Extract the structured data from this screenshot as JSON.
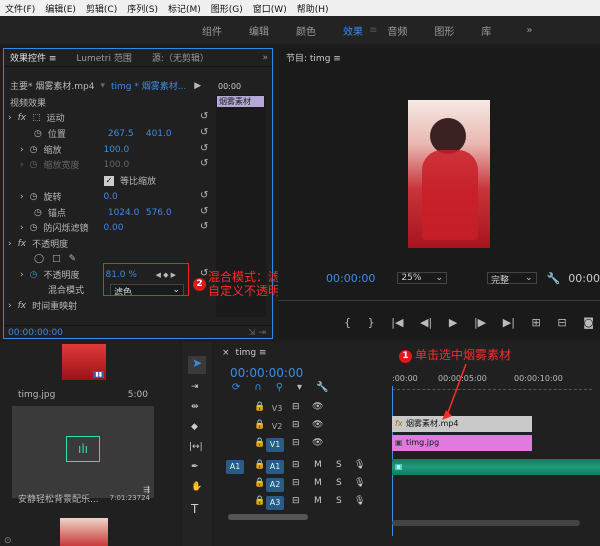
{
  "menu": [
    "文件(F)",
    "编辑(E)",
    "剪辑(C)",
    "序列(S)",
    "标记(M)",
    "图形(G)",
    "窗口(W)",
    "帮助(H)"
  ],
  "workspaces": [
    "组件",
    "编辑",
    "颜色",
    "效果",
    "音频",
    "图形",
    "库"
  ],
  "active_workspace": "效果",
  "effect_controls": {
    "tabs": [
      "效果控件 ≡",
      "Lumetri 范围",
      "源:（无剪辑）"
    ],
    "master_clip": "主要* 烟雾素材.mp4",
    "seq_clip": "timg * 烟雾素材...",
    "mini_time": "00:00",
    "mini_clip": "烟雾素材",
    "section_video": "视频效果",
    "motion": "运动",
    "position_label": "位置",
    "position_x": "267.5",
    "position_y": "401.0",
    "scale_label": "缩放",
    "scale_value": "100.0",
    "scale_width_label": "缩放宽度",
    "scale_width_value": "100.0",
    "uniform_scale": "等比缩放",
    "rotation_label": "旋转",
    "rotation_value": "0.0",
    "anchor_label": "锚点",
    "anchor_x": "1024.0",
    "anchor_y": "576.0",
    "antiflicker_label": "防闪烁滤镜",
    "antiflicker_value": "0.00",
    "opacity_section": "不透明度",
    "opacity_label": "不透明度",
    "opacity_value": "81.0 %",
    "blend_label": "混合模式",
    "blend_value": "滤色",
    "time_remap": "时间重映射",
    "timecode": "00:00:00:00"
  },
  "annotations": {
    "note2_line1": "混合模式：滤色",
    "note2_line2": "自定义不透明度",
    "note1": "单击选中烟雾素材",
    "badge1": "1",
    "badge2": "2"
  },
  "program": {
    "title": "节目: timg ≡",
    "timecode": "00:00:00",
    "zoom": "25%",
    "quality": "完整",
    "end_timecode": "00:00"
  },
  "project": {
    "item1_name": "timg.jpg",
    "item1_duration": "5:00",
    "item2_name": "安静轻松背景配乐...",
    "item2_duration": "7:01:23724"
  },
  "sequence": {
    "tab": "timg ≡",
    "timecode": "00:00:00:00",
    "ruler": [
      ":00:00",
      "00:00:05:00",
      "00:00:10:00"
    ],
    "tracks": [
      {
        "src": "",
        "name": "V3"
      },
      {
        "src": "",
        "name": "V2"
      },
      {
        "src": "",
        "name": "V1"
      },
      {
        "src": "A1",
        "name": "A1"
      },
      {
        "src": "",
        "name": "A2"
      },
      {
        "src": "",
        "name": "A3"
      }
    ],
    "clip_v2": "烟雾素材.mp4",
    "clip_v1": "timg.jpg",
    "m": "M",
    "s": "S"
  },
  "colors": {
    "accent": "#2d8ceb",
    "annotation": "#ff2a2a",
    "clip_pink": "#e07ae0",
    "clip_gray": "#c9c9c9",
    "clip_audio": "#1f9a7a"
  }
}
